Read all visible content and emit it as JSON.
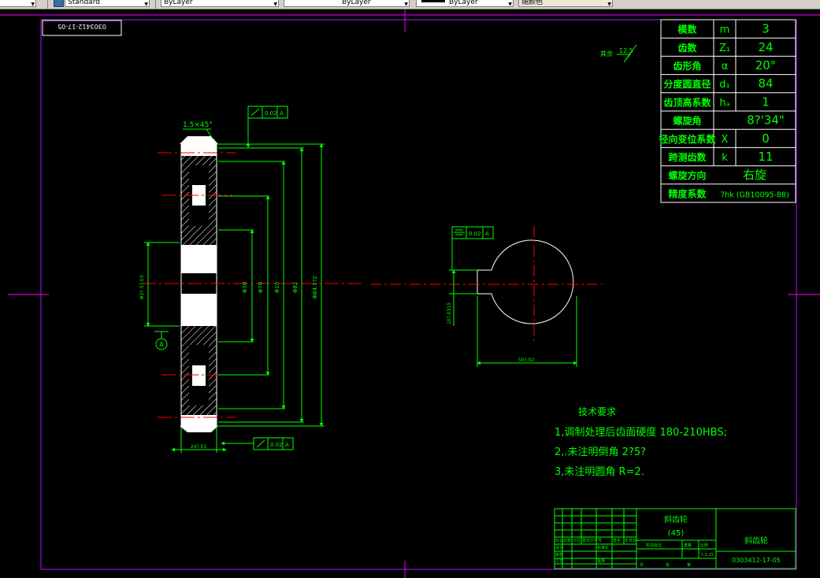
{
  "toolbar": {
    "textstyle_value": "Standard",
    "layer_value": "ByLayer",
    "linetype_value": "ByLayer",
    "lineweight_value": "ByLayer",
    "plotstyle_value": "随颜色"
  },
  "colors": {
    "background": "#000000",
    "drawing_lines": "#00ff00",
    "frame": "#ff00ff",
    "centerlines": "#ff0000",
    "gear_fill": "#ffffff",
    "hatch": "#ffffff"
  },
  "drawing": {
    "stamp_number": "0303412-17-05",
    "roughness_label": "其余",
    "roughness_value": "12.5",
    "chamfer_label": "1.5×45°",
    "tol_top_value": "0.02",
    "tol_top_datum": "A",
    "tol_bottom_value": "0.02",
    "tol_bottom_datum": "A",
    "tol_key_value": "0.02",
    "tol_key_datum": "A",
    "datum_letter": "A",
    "dim_width": "24?.01",
    "dim_bore_left": "Φ37.5?.03",
    "dim_d1": "Φ30",
    "dim_d2": "Φ70",
    "dim_d3": "Φ10",
    "dim_d4": "Φ82",
    "dim_d5": "Φ84.1?2",
    "dim_keyway_width": "10?.0315",
    "dim_keyway_depth": "50?.02"
  },
  "params": {
    "rows": [
      {
        "name": "模数",
        "symbol": "m",
        "value": "3"
      },
      {
        "name": "齿数",
        "symbol": "Z₁",
        "value": "24"
      },
      {
        "name": "齿形角",
        "symbol": "α",
        "value": "20°"
      },
      {
        "name": "分度圆直径",
        "symbol": "d₁",
        "value": "84"
      },
      {
        "name": "齿顶高系数",
        "symbol": "hₐ",
        "value": "1"
      },
      {
        "name": "螺旋角",
        "symbol": "",
        "value": "8?'34\""
      },
      {
        "name": "径向变位系数",
        "symbol": "X",
        "value": "0"
      },
      {
        "name": "跨测齿数",
        "symbol": "k",
        "value": "11"
      },
      {
        "name": "螺旋方向",
        "symbol": "",
        "value": "右旋"
      },
      {
        "name": "精度系数",
        "symbol": "",
        "value": "7hk (GB10095-88)"
      }
    ]
  },
  "requirements": {
    "title": "技术要求",
    "lines": [
      "1,调制处理后齿面硬度 180-210HBS;",
      "2,.未注明倒角 2?5?",
      "3,未注明圆角 R=2."
    ]
  },
  "titleblock": {
    "part_name": "斜齿轮",
    "material": "(45)",
    "drawing_name": "斜齿轮",
    "drawing_number": "0303412-17-05",
    "scale": "1:1.25",
    "h_mark": "标记",
    "h_count": "处数",
    "h_zone": "分区",
    "h_docno": "更改文件号",
    "h_sign": "签名",
    "h_date": "年月日",
    "h_designer": "设计",
    "h_std": "标准化",
    "h_review": "审核",
    "h_process": "工艺",
    "h_approve": "批准",
    "h_stage": "阶段标记",
    "h_weight": "重量",
    "h_ratio": "比例",
    "h_total": "共",
    "h_sheet": "张",
    "h_no": "第"
  }
}
